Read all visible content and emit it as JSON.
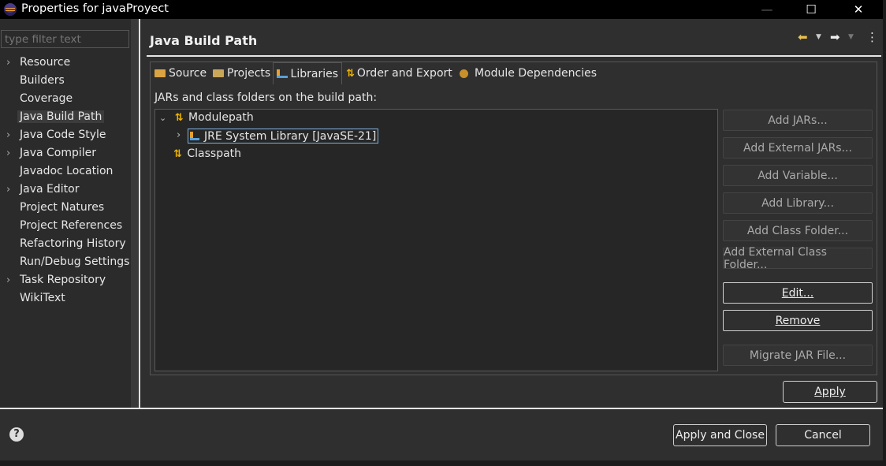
{
  "window": {
    "title": "Properties for javaProyect",
    "minimize": "—",
    "maximize": "☐",
    "close": "✕"
  },
  "sidebar": {
    "filter_placeholder": "type filter text",
    "items": [
      {
        "label": "Resource",
        "expandable": true
      },
      {
        "label": "Builders",
        "expandable": false
      },
      {
        "label": "Coverage",
        "expandable": false
      },
      {
        "label": "Java Build Path",
        "expandable": false,
        "selected": true
      },
      {
        "label": "Java Code Style",
        "expandable": true
      },
      {
        "label": "Java Compiler",
        "expandable": true
      },
      {
        "label": "Javadoc Location",
        "expandable": false
      },
      {
        "label": "Java Editor",
        "expandable": true
      },
      {
        "label": "Project Natures",
        "expandable": false
      },
      {
        "label": "Project References",
        "expandable": false
      },
      {
        "label": "Refactoring History",
        "expandable": false
      },
      {
        "label": "Run/Debug Settings",
        "expandable": false
      },
      {
        "label": "Task Repository",
        "expandable": true
      },
      {
        "label": "WikiText",
        "expandable": false
      }
    ]
  },
  "main": {
    "title": "Java Build Path",
    "tabs": [
      {
        "label": "Source"
      },
      {
        "label": "Projects"
      },
      {
        "label": "Libraries",
        "active": true
      },
      {
        "label": "Order and Export"
      },
      {
        "label": "Module Dependencies"
      }
    ],
    "description": "JARs and class folders on the build path:",
    "tree": {
      "modulepath": "Modulepath",
      "jre": "JRE System Library [JavaSE-21]",
      "classpath": "Classpath"
    },
    "buttons": {
      "add_jars": "Add JARs...",
      "add_external_jars": "Add External JARs...",
      "add_variable": "Add Variable...",
      "add_library": "Add Library...",
      "add_class_folder": "Add Class Folder...",
      "add_external_class_folder": "Add External Class Folder...",
      "edit": "Edit...",
      "remove": "Remove",
      "migrate": "Migrate JAR File..."
    },
    "apply": "Apply"
  },
  "footer": {
    "help": "?",
    "apply_close": "Apply and Close",
    "cancel": "Cancel"
  }
}
